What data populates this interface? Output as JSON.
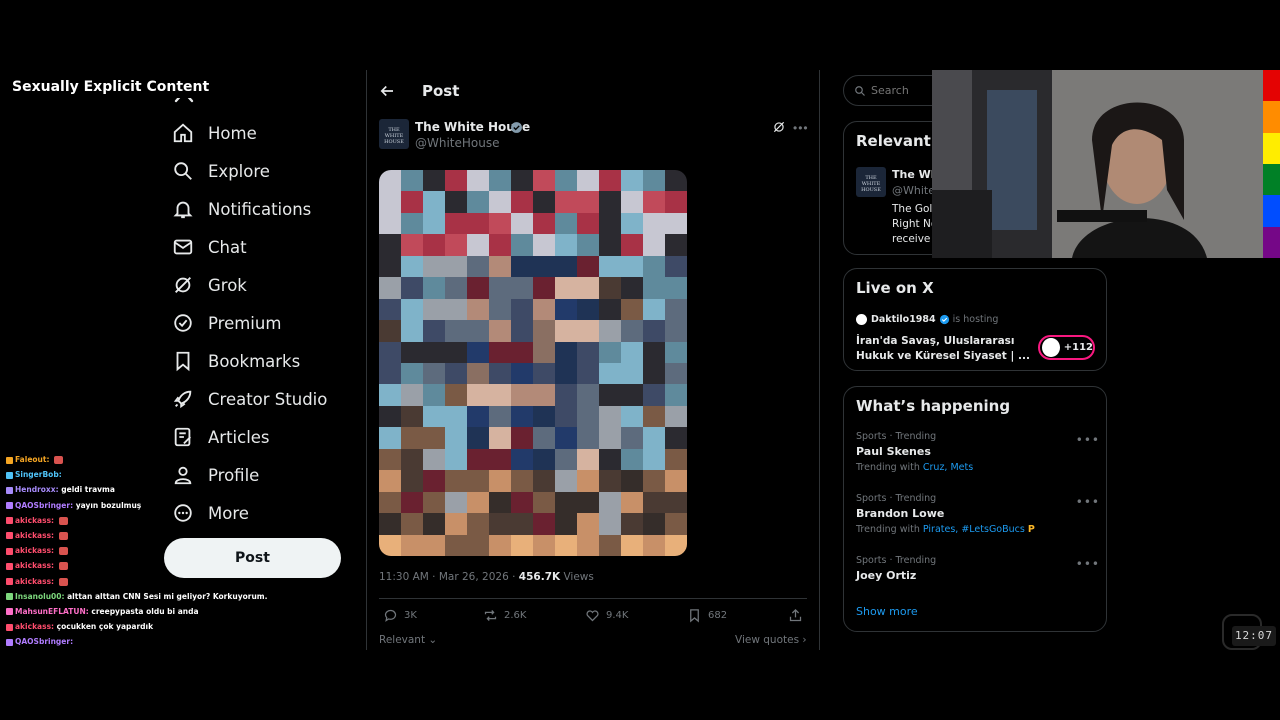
{
  "overlay_label": "Sexually Explicit Content",
  "nav": {
    "items": [
      {
        "label": "Home",
        "icon": "home-icon"
      },
      {
        "label": "Explore",
        "icon": "search-icon"
      },
      {
        "label": "Notifications",
        "icon": "bell-icon"
      },
      {
        "label": "Chat",
        "icon": "mail-icon"
      },
      {
        "label": "Grok",
        "icon": "grok-icon"
      },
      {
        "label": "Premium",
        "icon": "premium-icon"
      },
      {
        "label": "Bookmarks",
        "icon": "bookmark-icon"
      },
      {
        "label": "Creator Studio",
        "icon": "rocket-icon"
      },
      {
        "label": "Articles",
        "icon": "articles-icon"
      },
      {
        "label": "Profile",
        "icon": "person-icon"
      },
      {
        "label": "More",
        "icon": "more-circle-icon"
      }
    ],
    "post_button": "Post"
  },
  "chat": [
    {
      "user": "Faleout:",
      "color": "#f5a623",
      "msg": "",
      "emote": true
    },
    {
      "user": "SingerBob:",
      "color": "#4fc3f7",
      "msg": "",
      "emote": false
    },
    {
      "user": "Hendroxx:",
      "color": "#a78bfa",
      "msg": "geldi travma",
      "emote": false
    },
    {
      "user": "QAOSbringer:",
      "color": "#b07cff",
      "msg": "yayın bozulmuş",
      "emote": false
    },
    {
      "user": "akickass:",
      "color": "#ff4d6d",
      "msg": "",
      "emote": true
    },
    {
      "user": "akickass:",
      "color": "#ff4d6d",
      "msg": "",
      "emote": true
    },
    {
      "user": "akickass:",
      "color": "#ff4d6d",
      "msg": "",
      "emote": true
    },
    {
      "user": "akickass:",
      "color": "#ff4d6d",
      "msg": "",
      "emote": true
    },
    {
      "user": "akickass:",
      "color": "#ff4d6d",
      "msg": "",
      "emote": true
    },
    {
      "user": "Insanolu00:",
      "color": "#7dd87d",
      "msg": "alttan alttan CNN Sesi mi geliyor? Korkuyorum.",
      "emote": false
    },
    {
      "user": "MahsunEFLATUN:",
      "color": "#ff6fc8",
      "msg": "creepypasta oldu bi anda",
      "emote": false
    },
    {
      "user": "akickass:",
      "color": "#ff4d6d",
      "msg": "çocukken çok yapardık",
      "emote": false
    },
    {
      "user": "QAOSbringer:",
      "color": "#b07cff",
      "msg": "",
      "emote": false
    }
  ],
  "post": {
    "header_title": "Post",
    "author_name": "The White House",
    "author_handle": "@WhiteHouse",
    "avatar_text": "THE WHITE HOUSE",
    "timestamp": "11:30 AM · Mar 26, 2026 · ",
    "views_count": "456.7K",
    "views_label": " Views",
    "replies": "3K",
    "reposts": "2.6K",
    "likes": "9.4K",
    "bookmarks": "682",
    "relevant": "Relevant",
    "view_quotes": "View quotes"
  },
  "search": {
    "placeholder": "Search"
  },
  "relevant_card": {
    "title": "Relevant p",
    "name": "The Wh",
    "handle": "@White",
    "bio": "The Gol Right No receive"
  },
  "live": {
    "title": "Live on X",
    "host": "Daktilo1984",
    "hosting": "is hosting",
    "space_title": "İran'da Savaş, Uluslararası Hukuk ve Küresel Siyaset | ...",
    "listeners": "+112"
  },
  "happening": {
    "title": "What’s happening",
    "trends": [
      {
        "meta": "Sports · Trending",
        "name": "Paul Skenes",
        "with_label": "Trending with ",
        "with_links": "Cruz, Mets"
      },
      {
        "meta": "Sports · Trending",
        "name": "Brandon Lowe",
        "with_label": "Trending with ",
        "with_links": "Pirates, #LetsGoBucs"
      },
      {
        "meta": "Sports · Trending",
        "name": "Joey Ortiz",
        "with_label": "",
        "with_links": ""
      }
    ],
    "show_more": "Show more"
  },
  "clock": "12:07",
  "colors": {
    "accent": "#1d9bf0",
    "bg": "#000000",
    "border": "#2f3336",
    "muted": "#71767b"
  }
}
